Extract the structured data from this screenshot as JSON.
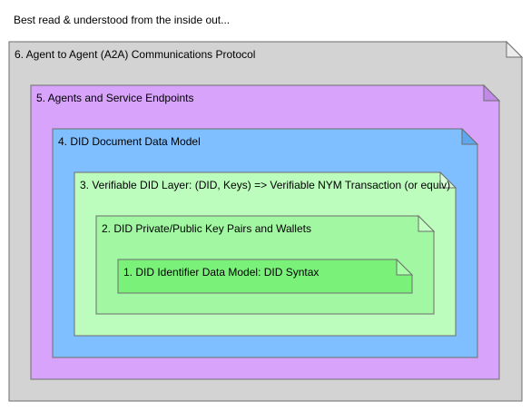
{
  "caption": "Best read & understood from the inside out...",
  "layers": [
    {
      "label": "6. Agent to Agent (A2A) Communications Protocol",
      "fill": "#d3d3d3",
      "fold": "#ececec"
    },
    {
      "label": "5. Agents and Service Endpoints",
      "fill": "#d7a3fb",
      "fold": "#c28ae8"
    },
    {
      "label": "4. DID Document Data Model",
      "fill": "#7fbfff",
      "fold": "#5fa6ec"
    },
    {
      "label": "3. Verifiable DID Layer: (DID, Keys) => Verifiable NYM Transaction (or equiv)",
      "fill": "#bcfcbc",
      "fold": "#d8ffd8"
    },
    {
      "label": "2. DID Private/Public Key Pairs and Wallets",
      "fill": "#a2f8a2",
      "fold": "#c4ffc4"
    },
    {
      "label": "1. DID Identifier Data Model: DID Syntax",
      "fill": "#7af27a",
      "fold": "#a8ffa8"
    }
  ]
}
